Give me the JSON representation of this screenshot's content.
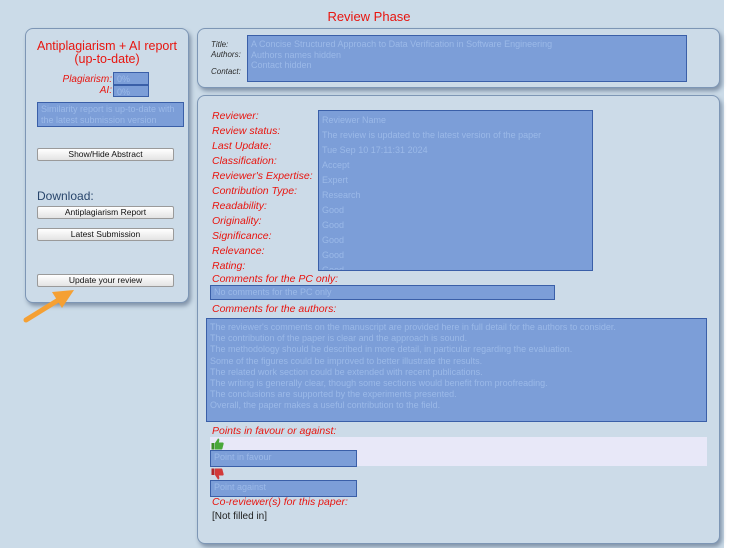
{
  "page": {
    "title": "Review Phase"
  },
  "sidebar": {
    "report_title": "Antiplagiarism + AI report (up-to-date)",
    "plagiarism_label": "Plagiarism:",
    "plagiarism_value": "0%",
    "ai_label": "AI:",
    "ai_value": "0%",
    "note": "Similarity report is up-to-date with the latest submission version",
    "show_hide_abstract": "Show/Hide Abstract",
    "download_label": "Download:",
    "antiplagiarism_report": "Antiplagiarism Report",
    "latest_submission": "Latest Submission",
    "update_review": "Update your review"
  },
  "paper_info": {
    "title_label": "Title:",
    "title_value": "A Concise Structured Approach to Data Verification in Software Engineering",
    "authors_label": "Authors:",
    "authors_value": "Authors names hidden",
    "contact_label": "Contact:",
    "contact_value": "Contact hidden"
  },
  "review": {
    "fields": [
      {
        "label": "Reviewer:",
        "value": "Reviewer Name"
      },
      {
        "label": "Review status:",
        "value": "The review is updated to the latest version of the paper"
      },
      {
        "label": "Last Update:",
        "value": "Tue Sep 10 17:11:31 2024"
      },
      {
        "label": "Classification:",
        "value": "Accept"
      },
      {
        "label": "Reviewer's Expertise:",
        "value": "Expert"
      },
      {
        "label": "Contribution Type:",
        "value": "Research"
      },
      {
        "label": "Readability:",
        "value": "Good"
      },
      {
        "label": "Originality:",
        "value": "Good"
      },
      {
        "label": "Significance:",
        "value": "Good"
      },
      {
        "label": "Relevance:",
        "value": "Good"
      },
      {
        "label": "Rating:",
        "value": "Good"
      }
    ],
    "pc_comments_label": "Comments for the PC only:",
    "pc_comments_value": "No comments for the PC only",
    "author_comments_label": "Comments for the authors:",
    "author_comments_lines": [
      "The reviewer's comments on the manuscript are provided here in full detail for the authors to consider.",
      "The contribution of the paper is clear and the approach is sound.",
      "The methodology should be described in more detail, in particular regarding the evaluation.",
      "Some of the figures could be improved to better illustrate the results.",
      "The related work section could be extended with recent publications.",
      "The writing is generally clear, though some sections would benefit from proofreading.",
      "The conclusions are supported by the experiments presented.",
      "Overall, the paper makes a useful contribution to the field."
    ],
    "favour_label": "Points in favour or against:",
    "favour_value": "Point in favour",
    "against_value": "Point against",
    "coreviewer_label": "Co-reviewer(s) for this paper:",
    "coreviewer_value": "[Not filled in]"
  },
  "colors": {
    "accent_red": "#e8150f",
    "redaction": "#7c9ed8",
    "panel_bg": "#ccdbe8",
    "arrow": "#f5a033"
  }
}
